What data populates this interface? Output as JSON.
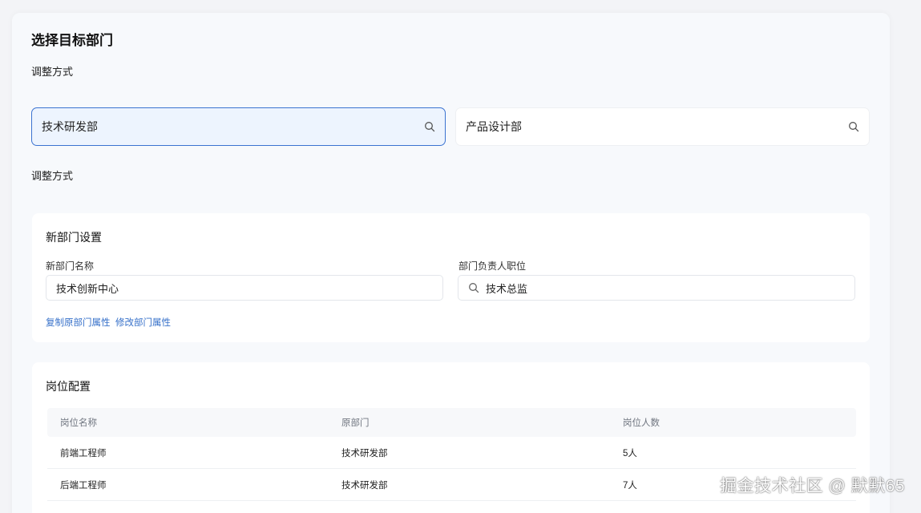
{
  "page": {
    "title": "选择目标部门",
    "adjust_label_1": "调整方式",
    "adjust_label_2": "调整方式"
  },
  "departments": {
    "left": {
      "name": "技术研发部",
      "icon": "search-icon"
    },
    "right": {
      "name": "产品设计部",
      "icon": "search-icon"
    }
  },
  "new_dept_settings": {
    "title": "新部门设置",
    "name_label": "新部门名称",
    "name_value": "技术创新中心",
    "leader_label": "部门负责人职位",
    "leader_value": "技术总监",
    "copy_link": "复制原部门属性",
    "modify_link": "修改部门属性"
  },
  "position_config": {
    "title": "岗位配置",
    "columns": [
      "岗位名称",
      "原部门",
      "岗位人数"
    ],
    "rows": [
      [
        "前端工程师",
        "技术研发部",
        "5人"
      ],
      [
        "后端工程师",
        "技术研发部",
        "7人"
      ]
    ]
  },
  "watermark": "掘金技术社区 @ 默默65",
  "colors": {
    "accent": "#3b73d1",
    "active_bg": "#edf4fe",
    "link": "#3670c9"
  }
}
